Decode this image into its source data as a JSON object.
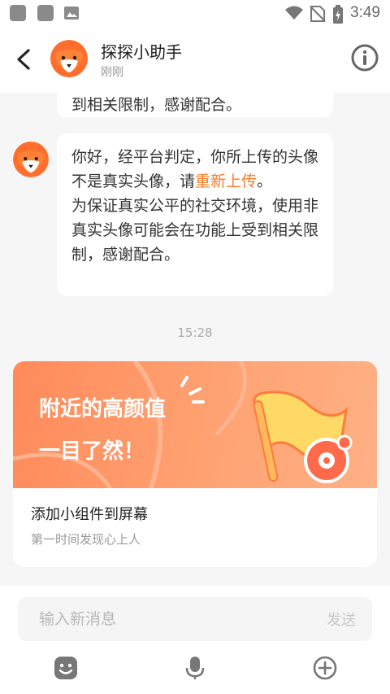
{
  "status_bar": {
    "time": "3:49"
  },
  "header": {
    "title": "探探小助手",
    "subtitle": "刚刚"
  },
  "chat": {
    "previous_message_fragment": "到相关限制，感谢配合。",
    "message": {
      "text_part1": "你好，经平台判定，你所上传的头像不是真实头像，请",
      "link_text": "重新上传",
      "text_part2": "。",
      "text_part3": "为保证真实公平的社交环境，使用非真实头像可能会在功能上受到相关限制，感谢配合。"
    },
    "timestamp": "15:28",
    "widget_card": {
      "banner_line1": "附近的高颜值",
      "banner_line2": "一目了然！",
      "title": "添加小组件到屏幕",
      "subtitle": "第一时间发现心上人"
    }
  },
  "input": {
    "placeholder": "输入新消息",
    "send_label": "发送"
  },
  "colors": {
    "accent": "#ff7a24",
    "banner": "#ff9a6a"
  }
}
